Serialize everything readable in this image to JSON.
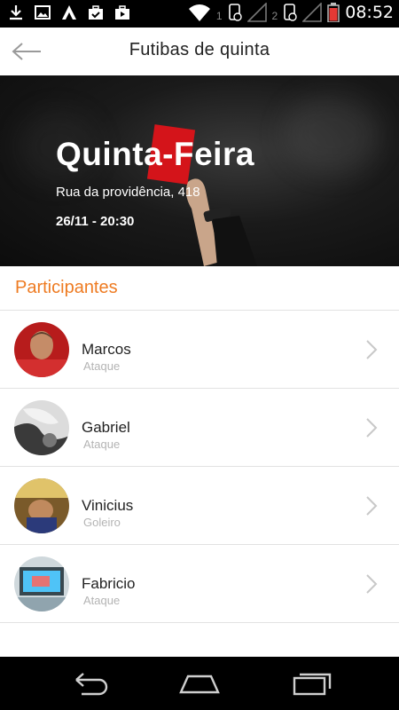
{
  "status_bar": {
    "time": "08:52",
    "sim1_label": "1",
    "sim2_label": "2",
    "left_icons": [
      "download-icon",
      "image-icon",
      "app-icon",
      "briefcase-check-icon",
      "play-briefcase-icon"
    ],
    "right_icons": [
      "wifi-icon",
      "signal-icon",
      "signal-icon",
      "battery-icon"
    ]
  },
  "app_bar": {
    "title": "Futibas de quinta",
    "back_icon": "arrow-left-icon"
  },
  "event": {
    "day": "Quinta-Feira",
    "address": "Rua da providência, 418",
    "datetime": "26/11 - 20:30"
  },
  "participants": {
    "title": "Participantes",
    "items": [
      {
        "name": "Marcos",
        "role": "Ataque"
      },
      {
        "name": "Gabriel",
        "role": "Ataque"
      },
      {
        "name": "Vinicius",
        "role": "Goleiro"
      },
      {
        "name": "Fabricio",
        "role": "Ataque"
      }
    ]
  },
  "colors": {
    "accent": "#ee7b22",
    "divider": "#e2e2e2",
    "role_text": "#b4b4b4"
  },
  "nav_bar": {
    "icons": [
      "back-nav-icon",
      "home-nav-icon",
      "recents-nav-icon"
    ]
  }
}
